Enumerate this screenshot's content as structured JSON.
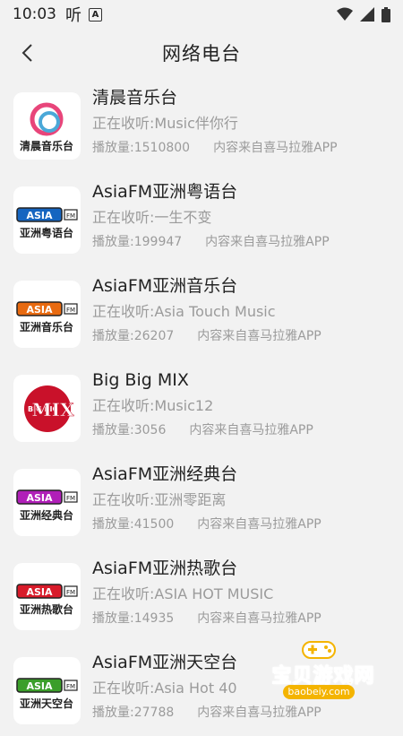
{
  "status_bar": {
    "time": "10:03",
    "glyph": "听",
    "badge": "A"
  },
  "header": {
    "title": "网络电台"
  },
  "stations": [
    {
      "name": "清晨音乐台",
      "now_playing": "正在收听:Music伴你行",
      "plays": "播放量:1510800",
      "source": "内容来自喜马拉雅APP",
      "logo_text": "清晨音乐台",
      "logo_color": "#e8457a"
    },
    {
      "name": "AsiaFM亚洲粤语台",
      "now_playing": "正在收听:一生不变",
      "plays": "播放量:199947",
      "source": "内容来自喜马拉雅APP",
      "logo_text": "亚洲粤语台",
      "logo_color": "#1565c0"
    },
    {
      "name": "AsiaFM亚洲音乐台",
      "now_playing": "正在收听:Asia Touch Music",
      "plays": "播放量:26207",
      "source": "内容来自喜马拉雅APP",
      "logo_text": "亚洲音乐台",
      "logo_color": "#e86a10"
    },
    {
      "name": "Big Big MIX",
      "now_playing": "正在收听:Music12",
      "plays": "播放量:3056",
      "source": "内容来自喜马拉雅APP",
      "logo_text": "MIX",
      "logo_color": "#c9112a"
    },
    {
      "name": "AsiaFM亚洲经典台",
      "now_playing": "正在收听:亚洲零距离",
      "plays": "播放量:41500",
      "source": "内容来自喜马拉雅APP",
      "logo_text": "亚洲经典台",
      "logo_color": "#b01fb8"
    },
    {
      "name": "AsiaFM亚洲热歌台",
      "now_playing": "正在收听:ASIA HOT MUSIC",
      "plays": "播放量:14935",
      "source": "内容来自喜马拉雅APP",
      "logo_text": "亚洲热歌台",
      "logo_color": "#d81b2a"
    },
    {
      "name": "AsiaFM亚洲天空台",
      "now_playing": "正在收听:Asia Hot 40",
      "plays": "播放量:27788",
      "source": "内容来自喜马拉雅APP",
      "logo_text": "亚洲天空台",
      "logo_color": "#3b9e2a"
    }
  ],
  "watermark": {
    "text": "宝贝游戏网",
    "url": "baobeiy.com"
  }
}
